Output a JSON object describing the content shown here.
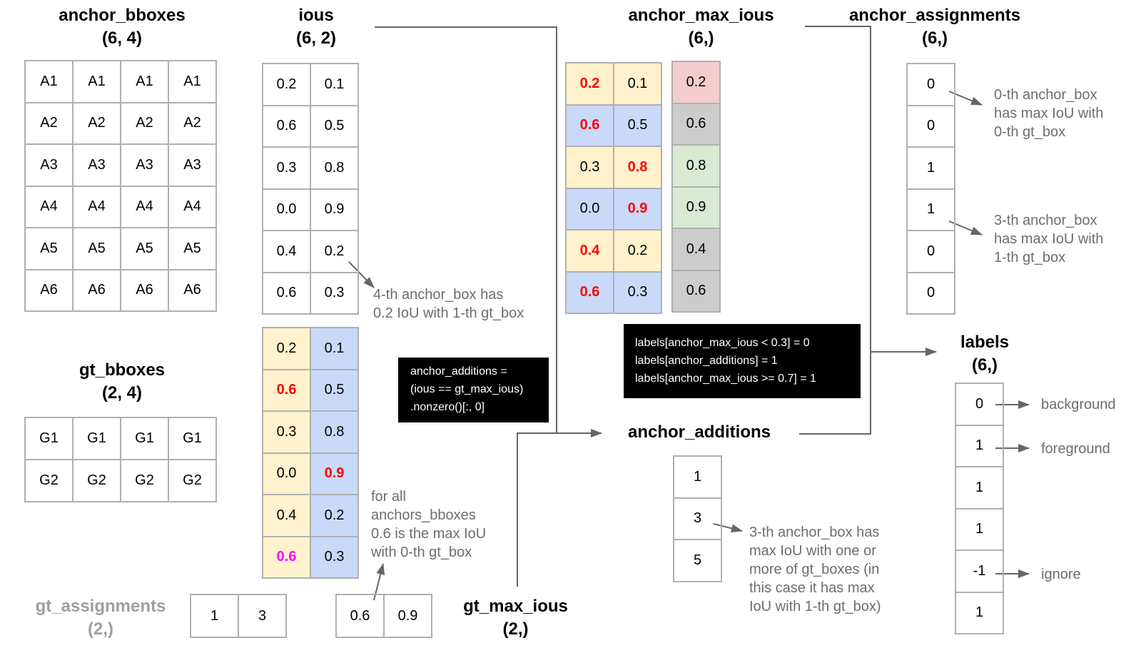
{
  "colors": {
    "gt0_column": "#fff2cc",
    "gt1_column": "#c9daf8",
    "below_threshold": "#f4cccc",
    "ignored": "#cccccc",
    "above_threshold": "#d9ead3",
    "highlight": "#ff0000",
    "gt_max_highlight": "#ff00ff",
    "connector": "#666666",
    "note_text": "#6d6d6d"
  },
  "anchor_bboxes": {
    "title": "anchor_bboxes",
    "shape": "(6, 4)",
    "rows": [
      [
        "A1",
        "A1",
        "A1",
        "A1"
      ],
      [
        "A2",
        "A2",
        "A2",
        "A2"
      ],
      [
        "A3",
        "A3",
        "A3",
        "A3"
      ],
      [
        "A4",
        "A4",
        "A4",
        "A4"
      ],
      [
        "A5",
        "A5",
        "A5",
        "A5"
      ],
      [
        "A6",
        "A6",
        "A6",
        "A6"
      ]
    ]
  },
  "gt_bboxes": {
    "title": "gt_bboxes",
    "shape": "(2, 4)",
    "rows": [
      [
        "G1",
        "G1",
        "G1",
        "G1"
      ],
      [
        "G2",
        "G2",
        "G2",
        "G2"
      ]
    ]
  },
  "ious": {
    "title": "ious",
    "shape": "(6, 2)",
    "rows": [
      [
        "0.2",
        "0.1"
      ],
      [
        "0.6",
        "0.5"
      ],
      [
        "0.3",
        "0.8"
      ],
      [
        "0.0",
        "0.9"
      ],
      [
        "0.4",
        "0.2"
      ],
      [
        "0.6",
        "0.3"
      ]
    ],
    "note": "4-th anchor_box has\n0.2 IoU with 1-th gt_box"
  },
  "ious_by_gt": {
    "rows": [
      [
        "0.2",
        "0.1"
      ],
      [
        "0.6",
        "0.5"
      ],
      [
        "0.3",
        "0.8"
      ],
      [
        "0.0",
        "0.9"
      ],
      [
        "0.4",
        "0.2"
      ],
      [
        "0.6",
        "0.3"
      ]
    ],
    "highlighted": [
      [
        1,
        0,
        "red"
      ],
      [
        3,
        1,
        "red"
      ],
      [
        5,
        0,
        "magenta"
      ]
    ],
    "note": "for all\nanchors_bboxes\n0.6 is the max IoU\nwith 0-th gt_box"
  },
  "gt_assignments": {
    "title": "gt_assignments",
    "shape": "(2,)",
    "values": [
      "1",
      "3"
    ]
  },
  "gt_max_ious": {
    "title": "gt_max_ious",
    "shape": "(2,)",
    "values": [
      "0.6",
      "0.9"
    ]
  },
  "anchor_additions_code": "anchor_additions =\n(ious == gt_max_ious)\n.nonzero()[:, 0]",
  "anchor_max_ious": {
    "title": "anchor_max_ious",
    "shape": "(6,)",
    "rows": [
      [
        "0.2",
        "0.1"
      ],
      [
        "0.6",
        "0.5"
      ],
      [
        "0.3",
        "0.8"
      ],
      [
        "0.0",
        "0.9"
      ],
      [
        "0.4",
        "0.2"
      ],
      [
        "0.6",
        "0.3"
      ]
    ],
    "row_max_index": [
      0,
      0,
      1,
      1,
      0,
      0
    ],
    "values": [
      "0.2",
      "0.6",
      "0.8",
      "0.9",
      "0.4",
      "0.6"
    ],
    "value_status": [
      "below",
      "ignored",
      "above",
      "above",
      "ignored",
      "ignored"
    ]
  },
  "anchor_assignments": {
    "title": "anchor_assignments",
    "shape": "(6,)",
    "values": [
      "0",
      "0",
      "1",
      "1",
      "0",
      "0"
    ],
    "notes": [
      "0-th anchor_box\nhas max IoU with\n0-th gt_box",
      "3-th anchor_box\nhas max IoU with\n1-th gt_box"
    ]
  },
  "labels_code": "labels[anchor_max_ious < 0.3] = 0\nlabels[anchor_additions] = 1\nlabels[anchor_max_ious >= 0.7] = 1",
  "anchor_additions": {
    "title": "anchor_additions",
    "values": [
      "1",
      "3",
      "5"
    ],
    "note": "3-th anchor_box has\nmax IoU with one or\nmore of gt_boxes (in\nthis case it has max\nIoU with 1-th gt_box)"
  },
  "labels": {
    "title": "labels",
    "shape": "(6,)",
    "values": [
      "0",
      "1",
      "1",
      "1",
      "-1",
      "1"
    ],
    "legend": {
      "background": "background",
      "foreground": "foreground",
      "ignore": "ignore"
    }
  }
}
